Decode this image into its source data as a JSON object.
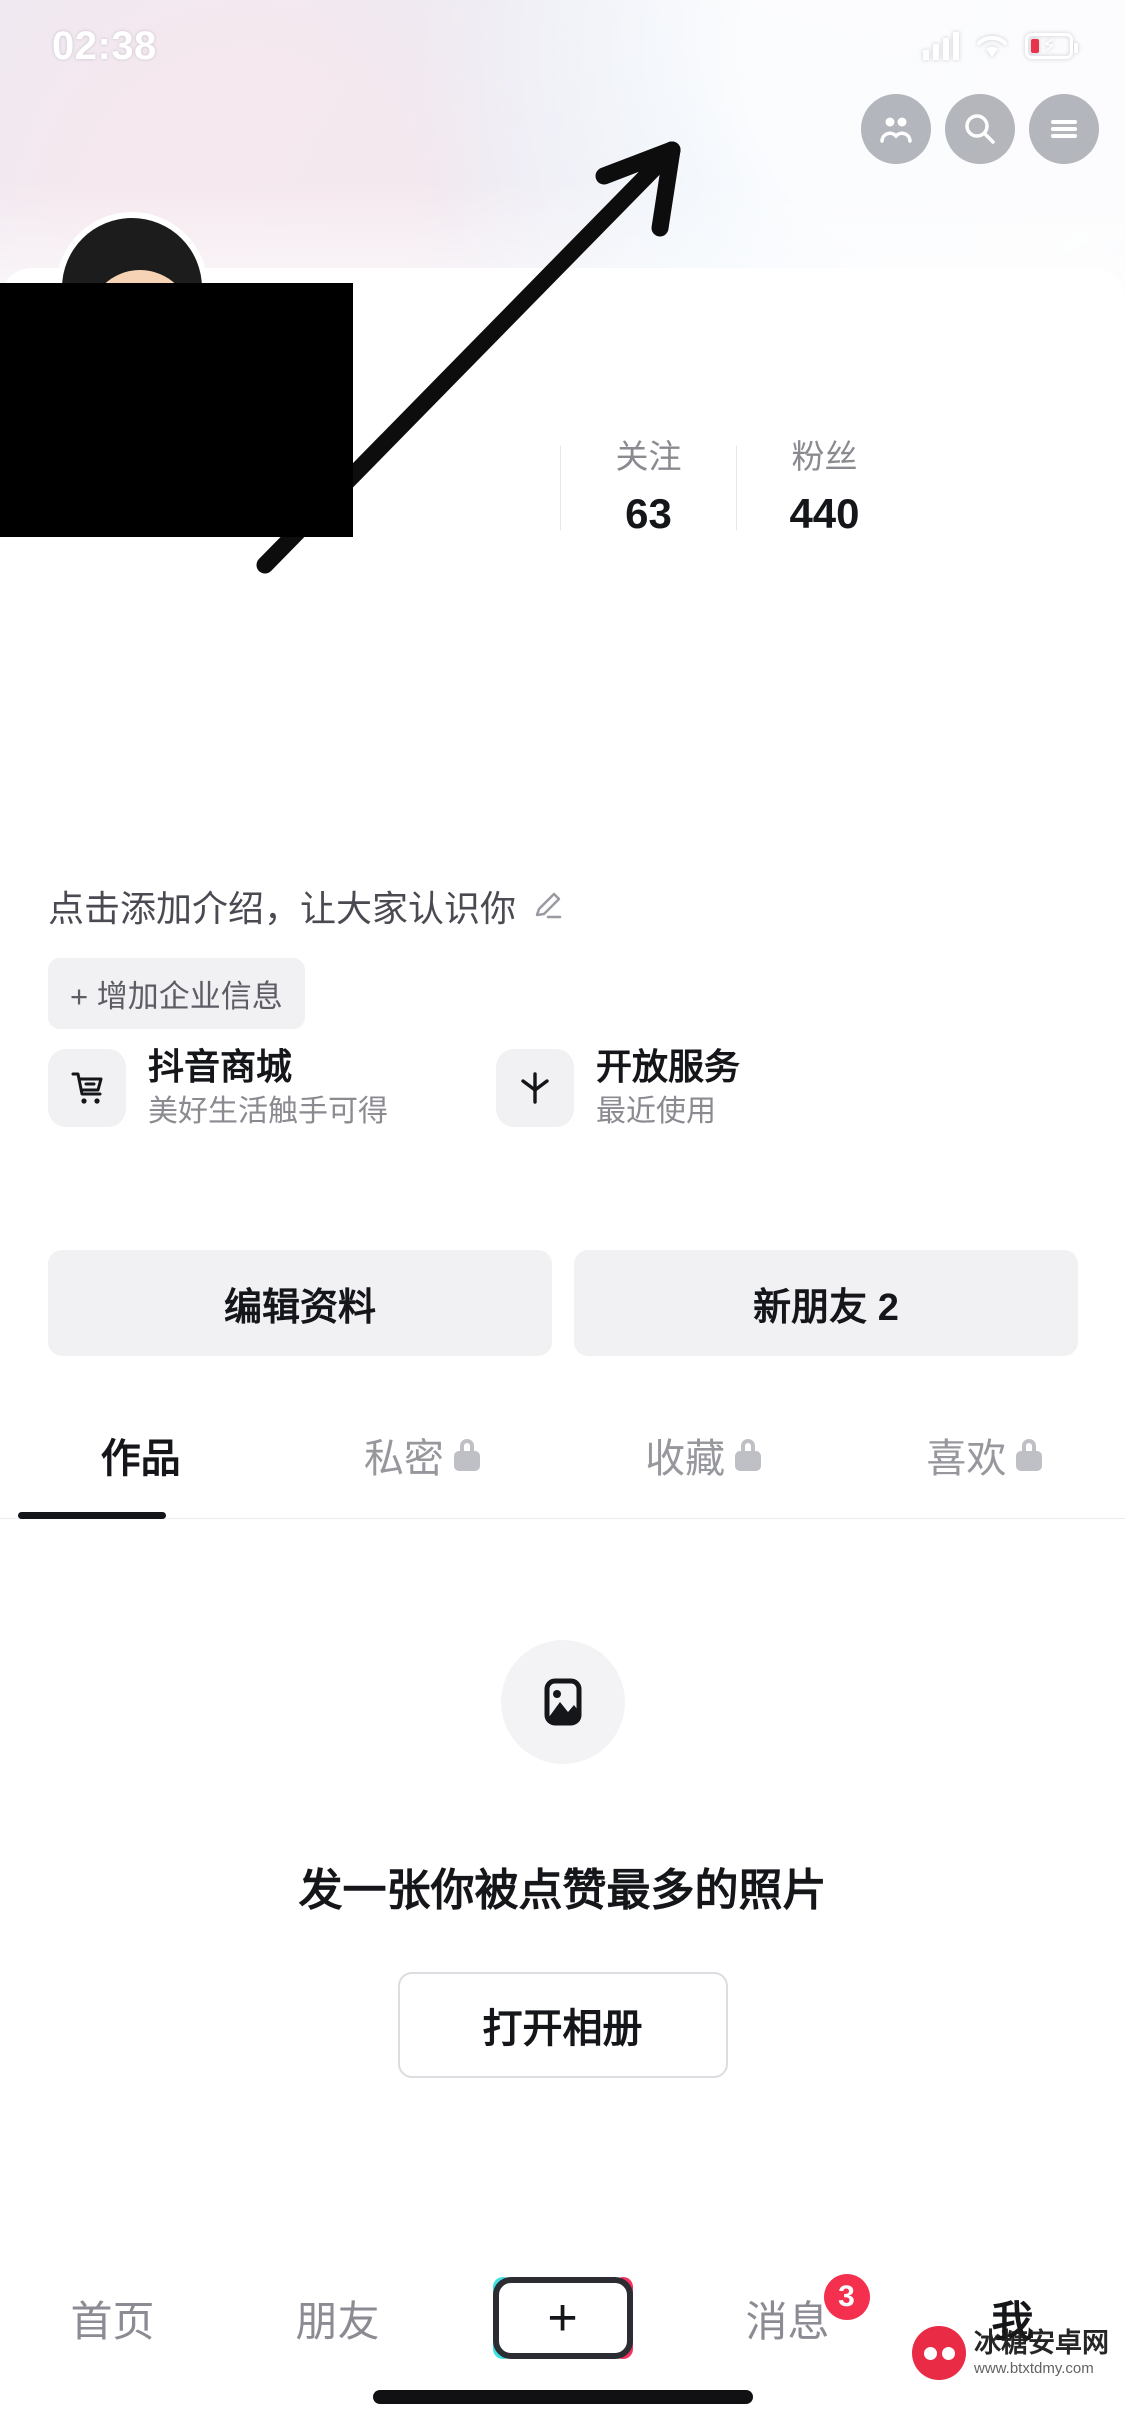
{
  "status_bar": {
    "time": "02:38",
    "moon_icon": "moon-icon",
    "signal_icon": "signal-bars-icon",
    "wifi_icon": "wifi-icon",
    "battery_icon": "battery-charging-icon"
  },
  "header": {
    "actions": [
      {
        "name": "friends-icon",
        "label": "好友"
      },
      {
        "name": "search-icon",
        "label": "搜索"
      },
      {
        "name": "menu-icon",
        "label": "菜单"
      }
    ]
  },
  "profile": {
    "avatar_name": "profile-avatar",
    "redacted_block": "redacted-username-block",
    "stats": [
      {
        "label": "关注",
        "value": "63"
      },
      {
        "label": "粉丝",
        "value": "440"
      }
    ],
    "bio_placeholder": "点击添加介绍，让大家认识你",
    "bio_edit_icon": "pencil-icon",
    "business_chip": "+ 增加企业信息"
  },
  "services": [
    {
      "icon": "shopping-cart-icon",
      "title": "抖音商城",
      "subtitle": "美好生活触手可得"
    },
    {
      "icon": "asterisk-icon",
      "title": "开放服务",
      "subtitle": "最近使用"
    }
  ],
  "actions": {
    "edit_profile": "编辑资料",
    "new_friends": "新朋友 2"
  },
  "tabs": [
    {
      "label": "作品",
      "locked": false,
      "active": true
    },
    {
      "label": "私密",
      "locked": true,
      "active": false
    },
    {
      "label": "收藏",
      "locked": true,
      "active": false
    },
    {
      "label": "喜欢",
      "locked": true,
      "active": false
    }
  ],
  "empty_state": {
    "icon": "image-placeholder-icon",
    "text": "发一张你被点赞最多的照片",
    "button": "打开相册"
  },
  "bottom_nav": [
    {
      "label": "首页",
      "active": false,
      "badge": ""
    },
    {
      "label": "朋友",
      "active": false,
      "badge": ""
    },
    {
      "label": "+",
      "active": false,
      "badge": "",
      "is_plus": true
    },
    {
      "label": "消息",
      "active": false,
      "badge": "3"
    },
    {
      "label": "我",
      "active": true,
      "badge": ""
    }
  ],
  "watermark": {
    "main": "冰糖安卓网",
    "sub": "www.btxtdmy.com"
  },
  "colors": {
    "accent_red": "#f4304e",
    "accent_cyan": "#3fe0e0",
    "text_primary": "#15161a",
    "text_secondary": "#8a8a90",
    "surface": "#f1f1f4"
  }
}
